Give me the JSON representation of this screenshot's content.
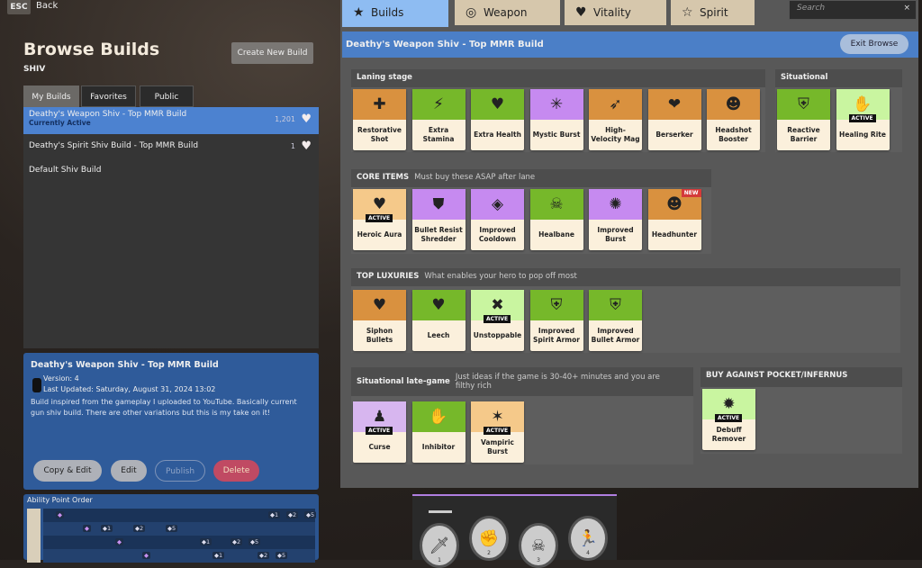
{
  "top": {
    "esc": "ESC",
    "back": "Back"
  },
  "left": {
    "title": "Browse Builds",
    "hero": "SHIV",
    "create": "Create New Build",
    "tabs": [
      "My Builds",
      "Favorites",
      "Public"
    ],
    "builds": [
      {
        "name": "Deathy's Weapon Shiv - Top MMR Build",
        "status": "Currently Active",
        "count": "1,201"
      },
      {
        "name": "Deathy's Spirit Shiv Build - Top MMR Build",
        "count": "1"
      },
      {
        "name": "Default Shiv Build"
      }
    ],
    "detail": {
      "title": "Deathy's Weapon Shiv - Top MMR Build",
      "version": "Version: 4",
      "updated": "Last Updated: Saturday, August 31, 2024 13:02",
      "desc": "Build inspired from the gameplay I uploaded to YouTube. Basically current gun shiv build. There are other variations but this is my take on it!",
      "buttons": [
        "Copy & Edit",
        "Edit",
        "Publish",
        "Delete"
      ]
    },
    "ability_order": {
      "label": "Ability Point Order",
      "rows": [
        [
          "◆",
          "◆1",
          "◆2",
          "◆5"
        ],
        [
          "◆",
          "◆1",
          "◆2",
          "◆5"
        ],
        [
          "◆",
          "◆1",
          "◆2",
          "◆5"
        ],
        [
          "◆",
          "◆1",
          "◆2",
          "◆5"
        ]
      ]
    }
  },
  "right": {
    "tabs": [
      {
        "label": "Builds",
        "icon": "★"
      },
      {
        "label": "Weapon",
        "icon": "◎"
      },
      {
        "label": "Vitality",
        "icon": "♥"
      },
      {
        "label": "Spirit",
        "icon": "☆"
      }
    ],
    "search_placeholder": "Search",
    "search_clear": "×",
    "build_title": "Deathy's Weapon Shiv - Top MMR Build",
    "exit": "Exit Browse",
    "active_label": "ACTIVE",
    "new_label": "NEW",
    "groups": [
      {
        "title": "Laning stage",
        "desc": "",
        "items": [
          {
            "name": "Restorative Shot",
            "color": "#d9913f",
            "icon": "✚"
          },
          {
            "name": "Extra Stamina",
            "color": "#76b82a",
            "icon": "⚡"
          },
          {
            "name": "Extra Health",
            "color": "#76b82a",
            "icon": "♥"
          },
          {
            "name": "Mystic Burst",
            "color": "#c68af0",
            "icon": "✳"
          },
          {
            "name": "High-Velocity Mag",
            "color": "#d9913f",
            "icon": "➶"
          },
          {
            "name": "Berserker",
            "color": "#d9913f",
            "icon": "❤"
          },
          {
            "name": "Headshot Booster",
            "color": "#d9913f",
            "icon": "☻"
          }
        ]
      },
      {
        "title": "Situational",
        "desc": "",
        "items": [
          {
            "name": "Reactive Barrier",
            "color": "#76b82a",
            "icon": "⛨"
          },
          {
            "name": "Healing Rite",
            "color": "#c9f5a0",
            "icon": "✋",
            "active": true
          }
        ]
      },
      {
        "title": "CORE ITEMS",
        "desc": "Must buy these ASAP after lane",
        "items": [
          {
            "name": "Heroic Aura",
            "color": "#f5c98a",
            "icon": "♥",
            "active": true
          },
          {
            "name": "Bullet Resist Shredder",
            "color": "#c68af0",
            "icon": "⛊"
          },
          {
            "name": "Improved Cooldown",
            "color": "#c68af0",
            "icon": "◈"
          },
          {
            "name": "Healbane",
            "color": "#76b82a",
            "icon": "☠"
          },
          {
            "name": "Improved Burst",
            "color": "#c68af0",
            "icon": "✺"
          },
          {
            "name": "Headhunter",
            "color": "#d9913f",
            "icon": "☻",
            "new": true
          }
        ]
      },
      {
        "title": "TOP LUXURIES",
        "desc": "What enables your hero to pop off most",
        "items": [
          {
            "name": "Siphon Bullets",
            "color": "#d9913f",
            "icon": "♥"
          },
          {
            "name": "Leech",
            "color": "#76b82a",
            "icon": "♥"
          },
          {
            "name": "Unstoppable",
            "color": "#c9f5a0",
            "icon": "✖",
            "active": true
          },
          {
            "name": "Improved Spirit Armor",
            "color": "#76b82a",
            "icon": "⛨"
          },
          {
            "name": "Improved Bullet Armor",
            "color": "#76b82a",
            "icon": "⛨"
          }
        ]
      },
      {
        "title": "Situational late-game",
        "desc": "Just ideas if the game is 30-40+ minutes and you are filthy rich",
        "items": [
          {
            "name": "Curse",
            "color": "#d7b6ef",
            "icon": "♟",
            "active": true
          },
          {
            "name": "Inhibitor",
            "color": "#76b82a",
            "icon": "✋"
          },
          {
            "name": "Vampiric Burst",
            "color": "#f5c98a",
            "icon": "✶",
            "active": true
          }
        ]
      },
      {
        "title": "BUY AGAINST POCKET/INFERNUS",
        "desc": "",
        "items": [
          {
            "name": "Debuff Remover",
            "color": "#c9f5a0",
            "icon": "✹",
            "active": true
          }
        ]
      }
    ]
  },
  "hud": {
    "abilities": [
      {
        "icon": "🗡",
        "level": "1"
      },
      {
        "icon": "✊",
        "level": "2"
      },
      {
        "icon": "☠",
        "level": "3"
      },
      {
        "icon": "🏃",
        "level": "4"
      }
    ]
  }
}
